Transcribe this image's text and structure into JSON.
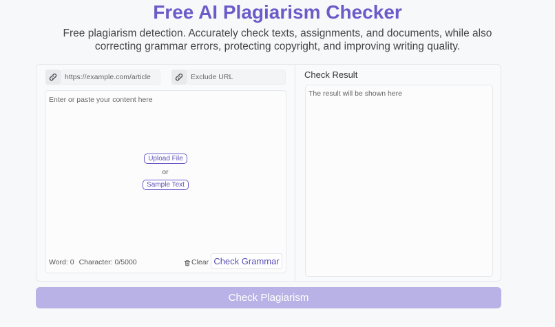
{
  "header": {
    "title": "Free AI Plagiarism Checker",
    "subtitle_line1": "Free plagiarism detection. Accurately check texts, assignments, and documents, while also",
    "subtitle_line2": "correcting grammar errors, protecting copyright, and improving writing quality."
  },
  "inputs": {
    "url_placeholder": "https://example.com/article",
    "exclude_url_placeholder": "Exclude URL",
    "link_icon": "link-icon"
  },
  "editor": {
    "placeholder": "Enter or paste your content here",
    "upload_label": "Upload File",
    "or_label": "or",
    "sample_label": "Sample Text",
    "word_label": "Word: 0",
    "char_label": "Character: 0/5000",
    "clear_label": "Clear",
    "clear_icon": "trash-icon",
    "grammar_label": "Check Grammar"
  },
  "result": {
    "label": "Check Result",
    "placeholder": "The result will be shown here"
  },
  "action": {
    "check_label": "Check Plagiarism"
  },
  "colors": {
    "accent": "#6a5bc9",
    "button_bg": "#b8b2e6"
  }
}
